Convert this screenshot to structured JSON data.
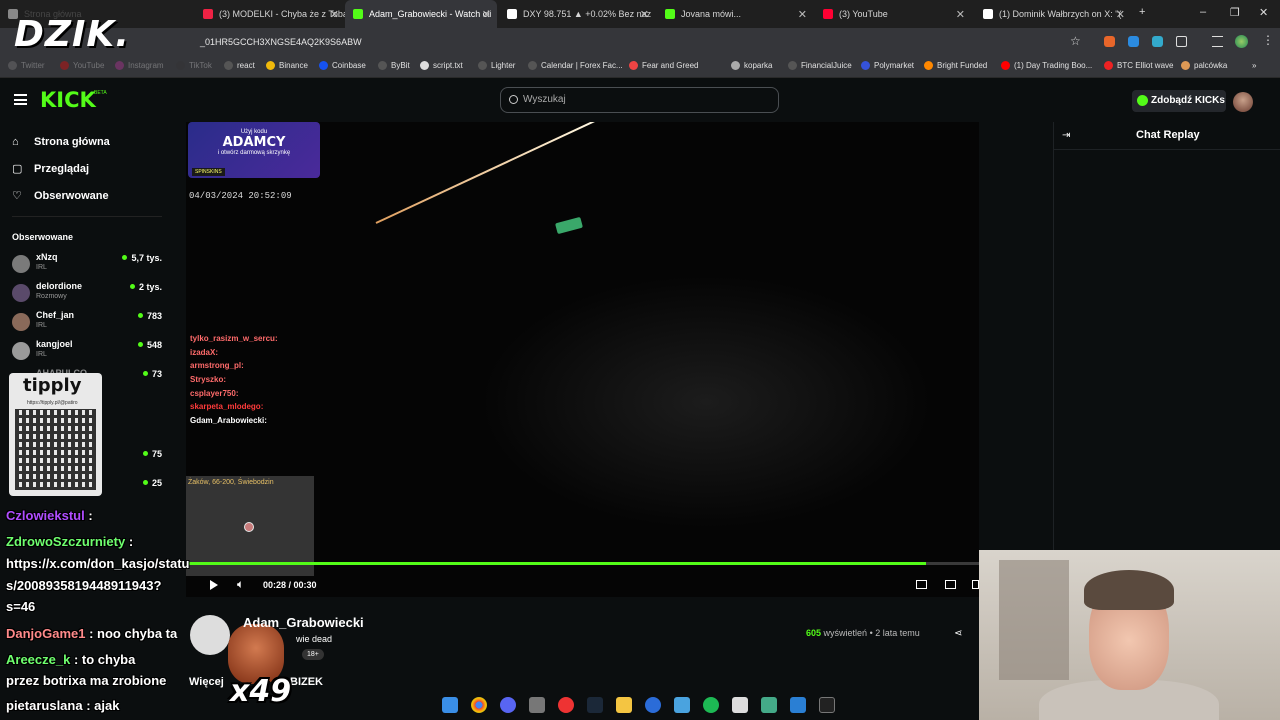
{
  "browser": {
    "tabs": [
      {
        "label": "Strona główna",
        "active": false
      },
      {
        "label": "(3) MODELKI - Chyba że z Tobą",
        "active": false
      },
      {
        "label": "Adam_Grabowiecki - Watch cli",
        "active": true
      },
      {
        "label": "DXY 98.751 ▲ +0.02% Bez naz",
        "active": false
      },
      {
        "label": "Jovana mówi...",
        "active": false
      },
      {
        "label": "(3) YouTube",
        "active": false
      },
      {
        "label": "(1) Dominik Wałbrzych on X: \"(",
        "active": false
      }
    ],
    "url": "_01HR5GCCH3XNGSE4AQ2K9S6ABW",
    "bookmarks": [
      "Twitter",
      "YouTube",
      "Instagram",
      "TikTok",
      "react",
      "Binance",
      "Coinbase",
      "ByBit",
      "script.txt",
      "Lighter",
      "Calendar | Forex Fac...",
      "Fear and Greed",
      "koparka",
      "FinancialJuice",
      "Polymarket",
      "Bright Funded",
      "(1) Day Trading Boo...",
      "BTC Elliot wave",
      "palcówka"
    ]
  },
  "overlay_logo": "DZIK.",
  "header": {
    "logo": "KICK",
    "beta": "BETA",
    "search_placeholder": "Wyszukaj",
    "kicks_button": "Zdobądź KICKs"
  },
  "sidebar": {
    "nav": [
      {
        "label": "Strona główna",
        "icon": "home-icon"
      },
      {
        "label": "Przeglądaj",
        "icon": "browse-icon"
      },
      {
        "label": "Obserwowane",
        "icon": "heart-icon"
      }
    ],
    "followed_title": "Obserwowane",
    "channels": [
      {
        "name": "xNzq",
        "category": "IRL",
        "viewers": "5,7 tys."
      },
      {
        "name": "delordione",
        "category": "Rozmowy",
        "viewers": "2 tys."
      },
      {
        "name": "Chef_jan",
        "category": "IRL",
        "viewers": "783"
      },
      {
        "name": "kangjoel",
        "category": "IRL",
        "viewers": "548"
      },
      {
        "name": "AHAPULCO",
        "category": "",
        "viewers": "73"
      },
      {
        "name": "",
        "category": "",
        "viewers": "75"
      },
      {
        "name": "",
        "category": "",
        "viewers": "25"
      }
    ]
  },
  "tipply": {
    "logo": "tipply",
    "url": "https://tipply.pl/@patiro"
  },
  "video": {
    "promo": {
      "line1": "Użyj kodu",
      "code": "ADAMCY",
      "line3": "i otwórz darmową skrzynkę",
      "brand": "SPINSKINS"
    },
    "timestamp": "04/03/2024 20:52:09",
    "overlay_chat": [
      {
        "user": "tylko_rasizm_w_sercu:",
        "color": "#ff6b6b"
      },
      {
        "user": "izadaX:",
        "color": "#ff6b6b"
      },
      {
        "user": "armstrong_pl:",
        "color": "#ff6b6b"
      },
      {
        "user": "Stryszko:",
        "color": "#ff6b6b"
      },
      {
        "user": "csplayer750:",
        "color": "#ff6b6b"
      },
      {
        "user": "skarpeta_mlodego:",
        "color": "#ff3b3b"
      },
      {
        "user": "Gdam_Arabowiecki:",
        "color": "#ffffff"
      }
    ],
    "minimap_label": "Żaków, 66-200, Świebodzin",
    "time": "00:28 / 00:30",
    "progress": 0.933
  },
  "clip": {
    "channel": "Adam_Grabowiecki",
    "title": "wie dead",
    "age_badge": "18+",
    "more_left": "Więcej",
    "more_right": "BIZEK",
    "views_count": "605",
    "views_label": "wyświetleń",
    "ago": "• 2 lata temu",
    "multiplier": "x49"
  },
  "chat_replay": {
    "title": "Chat Replay"
  },
  "overlay_messages": [
    {
      "user": "Czlowiekstul",
      "text": ":",
      "color": "#b04dff"
    },
    {
      "user": "ZdrowoSzczurniety",
      "text": ":",
      "color": "#6fff6f"
    },
    {
      "user": "",
      "text": "https://x.com/don_kasjo/statu",
      "color": "#ffffff"
    },
    {
      "user": "",
      "text": "s/2008935819448911943?",
      "color": "#ffffff"
    },
    {
      "user": "",
      "text": "s=46",
      "color": "#ffffff"
    },
    {
      "user": "DanjoGame1",
      "text": ": noo chyba ta",
      "color": "#ff8a8a"
    },
    {
      "user": "Areecze_k",
      "text": ": to chyba",
      "color": "#6fff6f"
    },
    {
      "user": "",
      "text": "przez botrixa ma zrobione",
      "color": "#ffffff"
    },
    {
      "user": "pietaruslana",
      "text": ": ajak",
      "color": "#ffffff"
    }
  ],
  "colors": {
    "accent": "#53fc18",
    "background": "#0b0e0f"
  }
}
